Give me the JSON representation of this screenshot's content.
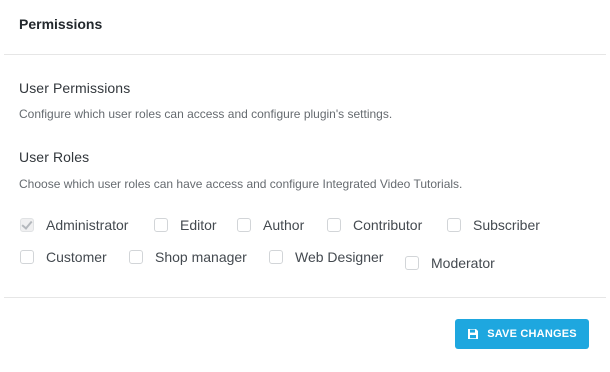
{
  "header": {
    "title": "Permissions"
  },
  "user_permissions": {
    "title": "User Permissions",
    "description": "Configure which user roles can access and configure plugin's settings."
  },
  "user_roles": {
    "title": "User Roles",
    "description": "Choose which user roles can have access and configure Integrated Video Tutorials.",
    "roles": [
      {
        "label": "Administrator",
        "checked": true
      },
      {
        "label": "Editor",
        "checked": false
      },
      {
        "label": "Author",
        "checked": false
      },
      {
        "label": "Contributor",
        "checked": false
      },
      {
        "label": "Subscriber",
        "checked": false
      },
      {
        "label": "Customer",
        "checked": false
      },
      {
        "label": "Shop manager",
        "checked": false
      },
      {
        "label": "Web Designer",
        "checked": false
      },
      {
        "label": "Moderator",
        "checked": false
      }
    ]
  },
  "footer": {
    "save_label": "SAVE CHANGES",
    "save_icon": "floppy-disk-icon"
  },
  "colors": {
    "accent": "#1ea7df",
    "divider": "#e6e6e6",
    "text": "#23282d",
    "muted": "#666b70"
  }
}
